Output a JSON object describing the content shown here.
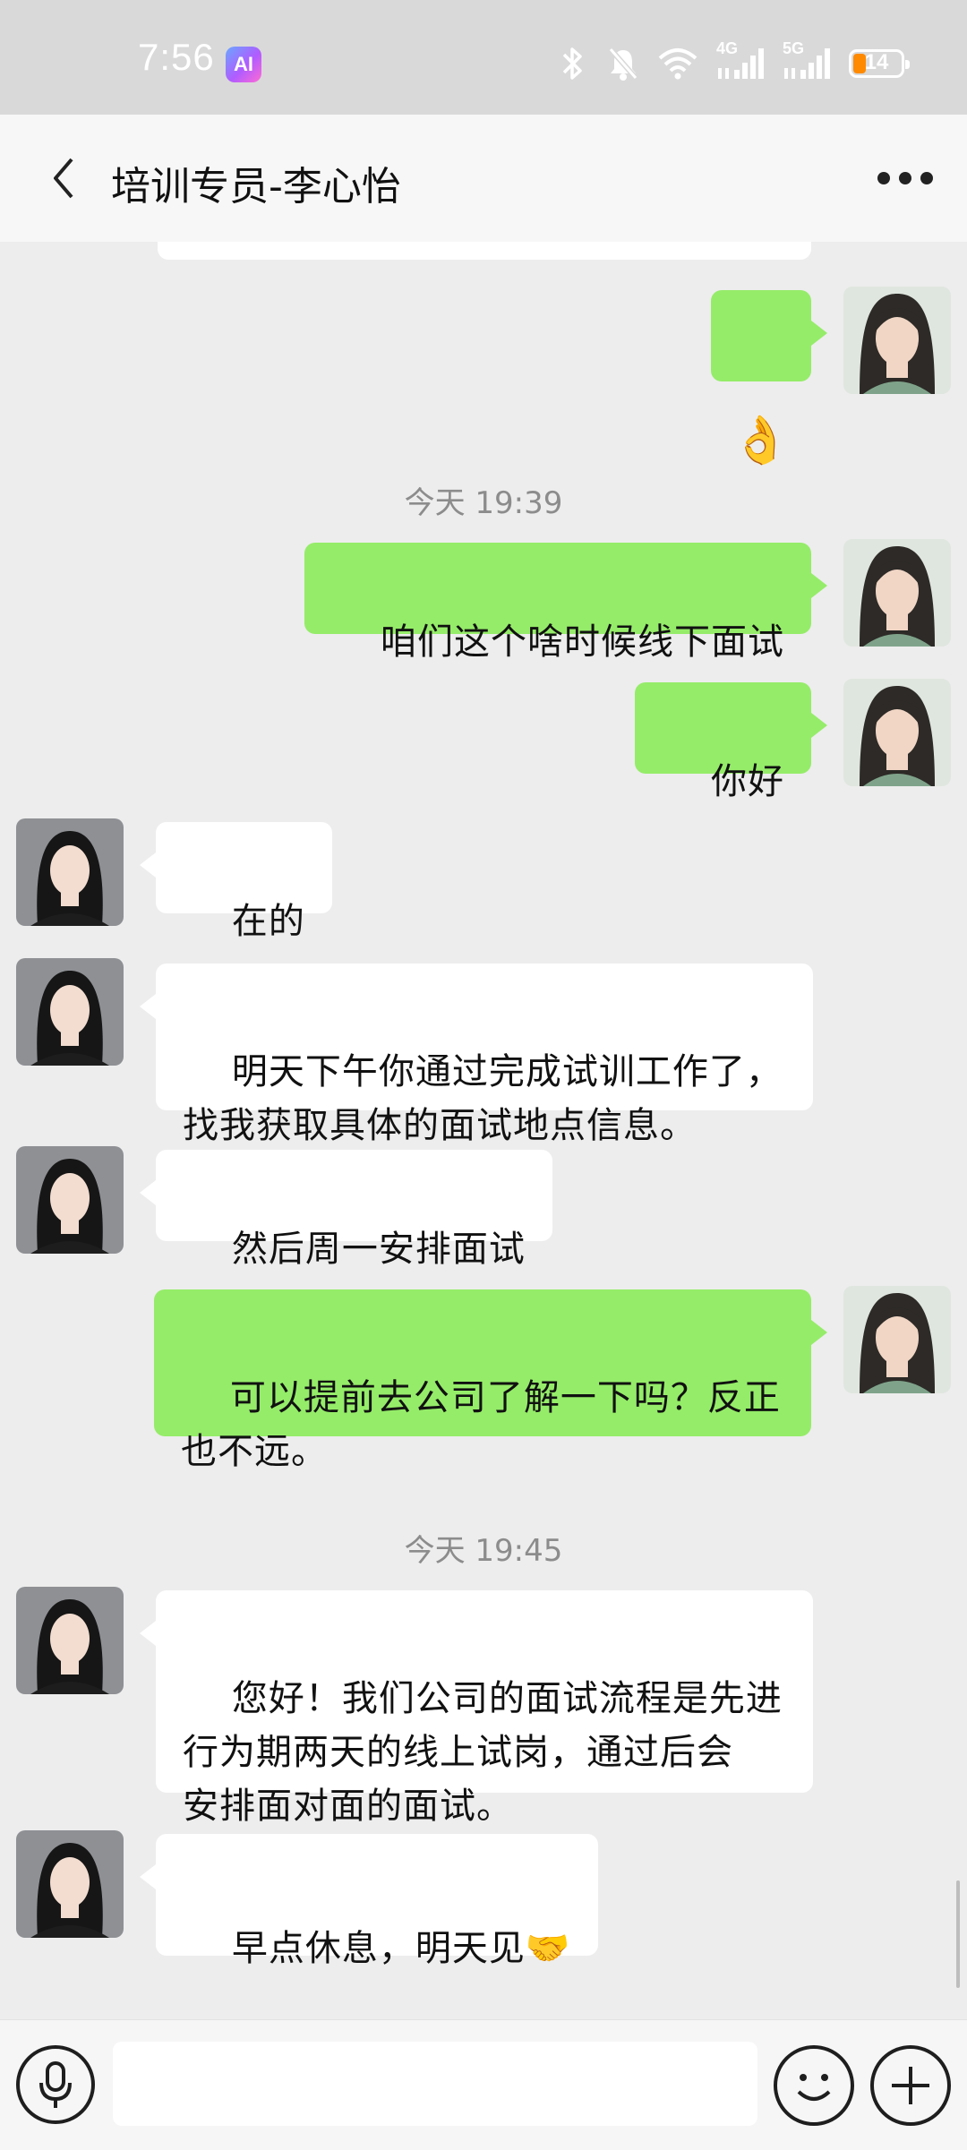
{
  "status_bar": {
    "time": "7:56",
    "ai_badge": "AI",
    "battery": "14",
    "net_4g": "4G",
    "net_5g": "5G"
  },
  "header": {
    "title": "培训专员-李心怡"
  },
  "messages": {
    "m1": {
      "text": "👌"
    },
    "ts1": "今天 19:39",
    "m2": {
      "text": "咱们这个啥时候线下面试"
    },
    "m3": {
      "text": "你好"
    },
    "m4": {
      "text": "在的"
    },
    "m5": {
      "text": "明天下午你通过完成试训工作了，\n找我获取具体的面试地点信息。"
    },
    "m6": {
      "text": "然后周一安排面试"
    },
    "m7": {
      "text": "可以提前去公司了解一下吗？反正\n也不远。"
    },
    "ts2": "今天 19:45",
    "m8": {
      "text": "您好！我们公司的面试流程是先进\n行为期两天的线上试岗，通过后会\n安排面对面的面试。"
    },
    "m9": {
      "text": "早点休息，明天见🤝"
    }
  },
  "input": {
    "placeholder": "",
    "value": ""
  },
  "colors": {
    "sent_bubble": "#95ec69",
    "received_bubble": "#ffffff",
    "background": "#ededed"
  }
}
